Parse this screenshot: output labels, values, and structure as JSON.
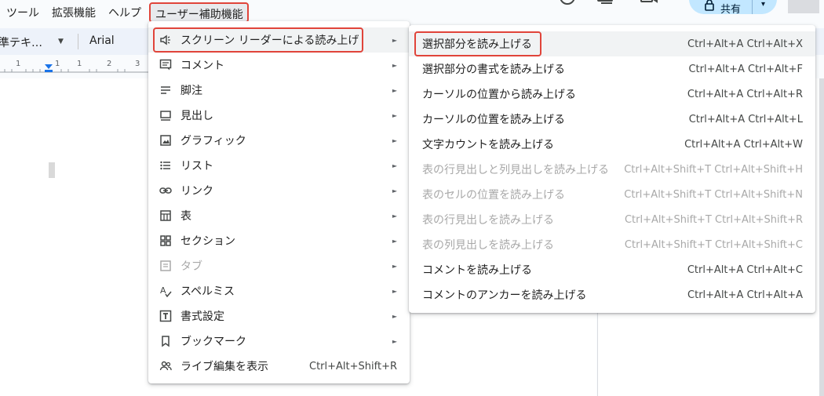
{
  "menubar": {
    "items": [
      "ツール",
      "拡張機能",
      "ヘルプ",
      "ユーザー補助機能"
    ]
  },
  "header": {
    "share_label": "共有"
  },
  "toolbar": {
    "paragraph_style": "準テキ…",
    "font": "Arial"
  },
  "ruler": {
    "marks": [
      "1",
      "1",
      "1",
      "2",
      "3"
    ]
  },
  "accessibility_menu": {
    "items": [
      {
        "label": "スクリーン リーダーによる読み上げ",
        "icon": "speaker-icon",
        "arrow": "►",
        "disabled": false
      },
      {
        "label": "コメント",
        "icon": "comment-icon",
        "arrow": "►",
        "disabled": false
      },
      {
        "label": "脚注",
        "icon": "footnote-icon",
        "arrow": "►",
        "disabled": false
      },
      {
        "label": "見出し",
        "icon": "heading-icon",
        "arrow": "►",
        "disabled": false
      },
      {
        "label": "グラフィック",
        "icon": "image-icon",
        "arrow": "►",
        "disabled": false
      },
      {
        "label": "リスト",
        "icon": "list-icon",
        "arrow": "►",
        "disabled": false
      },
      {
        "label": "リンク",
        "icon": "link-icon",
        "arrow": "►",
        "disabled": false
      },
      {
        "label": "表",
        "icon": "table-icon",
        "arrow": "►",
        "disabled": false
      },
      {
        "label": "セクション",
        "icon": "section-icon",
        "arrow": "►",
        "disabled": false
      },
      {
        "label": "タブ",
        "icon": "tab-icon",
        "arrow": "►",
        "disabled": true
      },
      {
        "label": "スペルミス",
        "icon": "spellcheck-icon",
        "arrow": "►",
        "disabled": false
      },
      {
        "label": "書式設定",
        "icon": "format-icon",
        "arrow": "►",
        "disabled": false
      },
      {
        "label": "ブックマーク",
        "icon": "bookmark-icon",
        "arrow": "►",
        "disabled": false
      },
      {
        "label": "ライブ編集を表示",
        "icon": "people-icon",
        "shortcut": "Ctrl+Alt+Shift+R",
        "disabled": false
      }
    ]
  },
  "screen_reader_submenu": {
    "items": [
      {
        "label": "選択部分を読み上げる",
        "shortcut": "Ctrl+Alt+A Ctrl+Alt+X",
        "disabled": false
      },
      {
        "label": "選択部分の書式を読み上げる",
        "shortcut": "Ctrl+Alt+A Ctrl+Alt+F",
        "disabled": false
      },
      {
        "label": "カーソルの位置から読み上げる",
        "shortcut": "Ctrl+Alt+A Ctrl+Alt+R",
        "disabled": false
      },
      {
        "label": "カーソルの位置を読み上げる",
        "shortcut": "Ctrl+Alt+A Ctrl+Alt+L",
        "disabled": false
      },
      {
        "label": "文字カウントを読み上げる",
        "shortcut": "Ctrl+Alt+A Ctrl+Alt+W",
        "disabled": false
      },
      {
        "label": "表の行見出しと列見出しを読み上げる",
        "shortcut": "Ctrl+Alt+Shift+T Ctrl+Alt+Shift+H",
        "disabled": true
      },
      {
        "label": "表のセルの位置を読み上げる",
        "shortcut": "Ctrl+Alt+Shift+T Ctrl+Alt+Shift+N",
        "disabled": true
      },
      {
        "label": "表の行見出しを読み上げる",
        "shortcut": "Ctrl+Alt+Shift+T Ctrl+Alt+Shift+R",
        "disabled": true
      },
      {
        "label": "表の列見出しを読み上げる",
        "shortcut": "Ctrl+Alt+Shift+T Ctrl+Alt+Shift+C",
        "disabled": true
      },
      {
        "label": "コメントを読み上げる",
        "shortcut": "Ctrl+Alt+A Ctrl+Alt+C",
        "disabled": false
      },
      {
        "label": "コメントのアンカーを読み上げる",
        "shortcut": "Ctrl+Alt+A Ctrl+Alt+A",
        "disabled": false
      }
    ]
  },
  "colors": {
    "highlight_border": "#e0443a",
    "hover_bg": "#f1f3f4",
    "share_bg": "#c2e7ff",
    "disabled_text": "#a8a8a8"
  }
}
